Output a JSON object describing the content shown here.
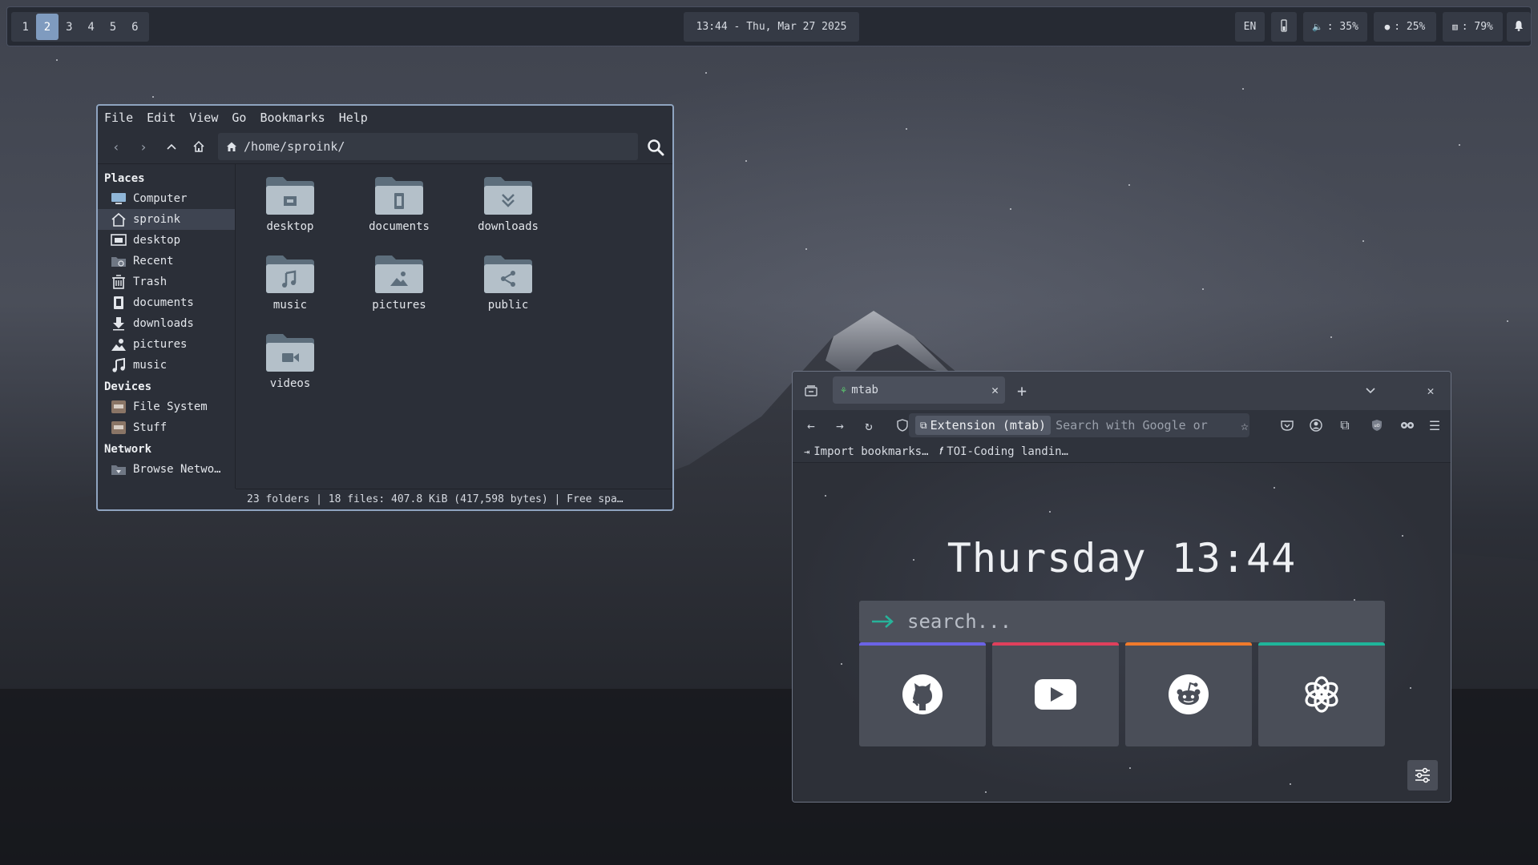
{
  "topbar": {
    "workspaces": [
      "1",
      "2",
      "3",
      "4",
      "5",
      "6"
    ],
    "active_workspace": "2",
    "clock": "13:44 - Thu, Mar 27 2025",
    "language": "EN",
    "volume": ": 35%",
    "cpu": ": 25%",
    "memory": ": 79%"
  },
  "file_manager": {
    "menu": [
      "File",
      "Edit",
      "View",
      "Go",
      "Bookmarks",
      "Help"
    ],
    "path": "/home/sproink/",
    "sidebar": {
      "places_heading": "Places",
      "places": [
        "Computer",
        "sproink",
        "desktop",
        "Recent",
        "Trash",
        "documents",
        "downloads",
        "pictures",
        "music"
      ],
      "devices_heading": "Devices",
      "devices": [
        "File System",
        "Stuff"
      ],
      "network_heading": "Network",
      "network": [
        "Browse Netwo…"
      ]
    },
    "folders": [
      "desktop",
      "documents",
      "downloads",
      "music",
      "pictures",
      "public",
      "videos"
    ],
    "status": "23 folders  |  18 files: 407.8 KiB (417,598 bytes)  |  Free spa…"
  },
  "browser": {
    "tab_title": "mtab",
    "url_chip": "Extension (mtab)",
    "url_placeholder": "Search with Google or",
    "bookmarks": [
      "Import bookmarks…",
      "TOI-Coding landin…"
    ],
    "page": {
      "clock": "Thursday 13:44",
      "search_placeholder": "search...",
      "tiles": [
        {
          "name": "GitHub",
          "accent": "#6b63e6"
        },
        {
          "name": "YouTube",
          "accent": "#e0405c"
        },
        {
          "name": "Reddit",
          "accent": "#f07a2b"
        },
        {
          "name": "ChatGPT",
          "accent": "#1fb59a"
        }
      ]
    }
  }
}
